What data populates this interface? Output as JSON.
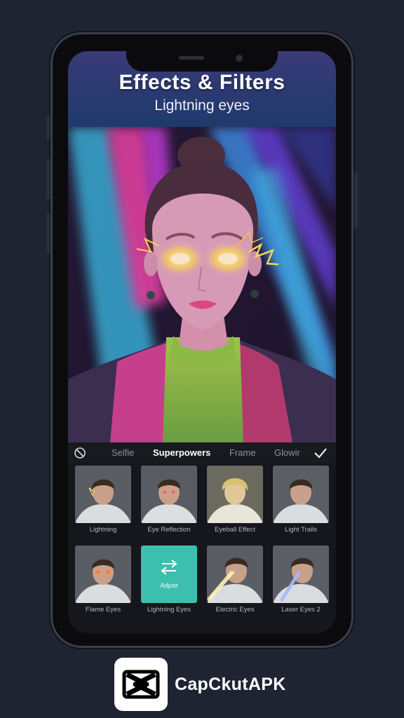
{
  "header": {
    "title": "Effects & Filters",
    "subtitle": "Lightning eyes"
  },
  "toolbar": {
    "none_icon": "no-effect-icon",
    "tabs": [
      "Selfie",
      "Superpowers",
      "Frame",
      "Glowir"
    ],
    "active_tab": "Superpowers",
    "confirm_icon": "checkmark-icon"
  },
  "effects": [
    {
      "label": "Lightning"
    },
    {
      "label": "Eye Reflection"
    },
    {
      "label": "Eyeball Effect"
    },
    {
      "label": "Light Trails"
    },
    {
      "label": "Flame Eyes"
    },
    {
      "label": "Lightning Eyes",
      "selected": true,
      "adjust_label": "Adjust"
    },
    {
      "label": "Electric Eyes"
    },
    {
      "label": "Laser Eyes 2"
    }
  ],
  "brand": {
    "name": "CapCkutAPK",
    "logo_icon": "capcut-logo-icon"
  },
  "colors": {
    "background": "#1f2433",
    "selected_tile": "#3cbfae",
    "effect_glow": "#ffe94a"
  }
}
